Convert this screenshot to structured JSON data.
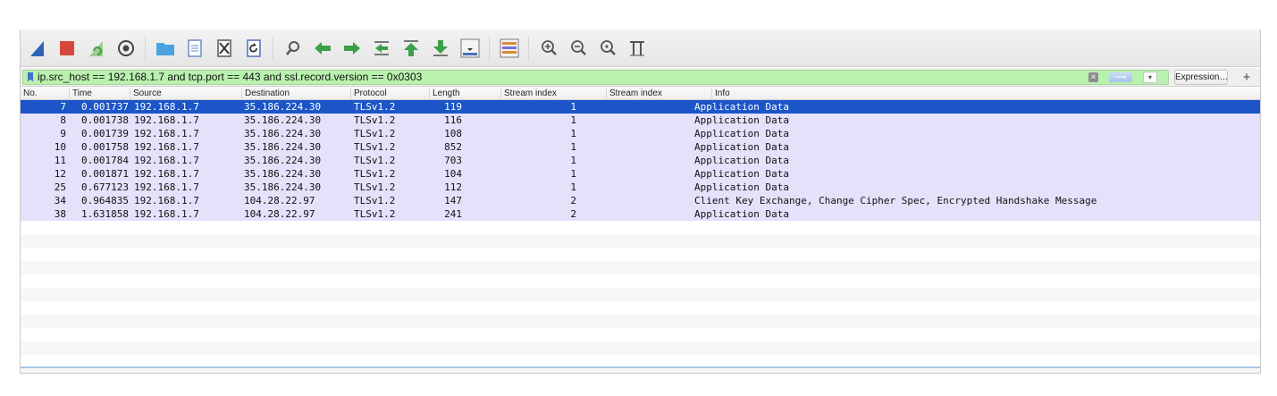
{
  "toolbar": {
    "buttons": [
      {
        "name": "start-capture-icon",
        "color": "#2f63b6"
      },
      {
        "name": "stop-capture-icon",
        "color": "#d6483c"
      },
      {
        "name": "restart-capture-icon",
        "color": "#3f9b3f"
      },
      {
        "name": "capture-options-icon",
        "color": "#444444"
      },
      {
        "name": "open-file-icon",
        "color": "#4aa3e0"
      },
      {
        "name": "save-file-icon",
        "color": "#6a8cc8"
      },
      {
        "name": "close-file-icon",
        "color": "#555555"
      },
      {
        "name": "reload-file-icon",
        "color": "#4a6fb5"
      },
      {
        "name": "find-packet-icon",
        "color": "#555555"
      },
      {
        "name": "go-back-icon",
        "color": "#3aa04a"
      },
      {
        "name": "go-forward-icon",
        "color": "#3aa04a"
      },
      {
        "name": "go-to-packet-icon",
        "color": "#3aa04a"
      },
      {
        "name": "go-first-packet-icon",
        "color": "#3aa04a"
      },
      {
        "name": "go-last-packet-icon",
        "color": "#3aa04a"
      },
      {
        "name": "auto-scroll-icon",
        "color": "#4a6fb5"
      },
      {
        "name": "colorize-icon",
        "color": "#d88c3a"
      },
      {
        "name": "zoom-in-icon",
        "color": "#555555"
      },
      {
        "name": "zoom-out-icon",
        "color": "#555555"
      },
      {
        "name": "normal-size-icon",
        "color": "#555555"
      },
      {
        "name": "resize-columns-icon",
        "color": "#555555"
      }
    ]
  },
  "filter": {
    "value": "ip.src_host == 192.168.1.7 and tcp.port == 443 and ssl.record.version == 0x0303",
    "valid_color": "#b9f1ae",
    "expression_label": "Expression…",
    "plus_label": "+"
  },
  "columns": [
    "No.",
    "Time",
    "Source",
    "Destination",
    "Protocol",
    "Length",
    "Stream index",
    "Stream index",
    "Info"
  ],
  "packets": [
    {
      "no": "7",
      "time": "0.001737",
      "src": "192.168.1.7",
      "dst": "35.186.224.30",
      "proto": "TLSv1.2",
      "len": "119",
      "stream1": "1",
      "stream2": "",
      "info": "Application Data",
      "selected": true
    },
    {
      "no": "8",
      "time": "0.001738",
      "src": "192.168.1.7",
      "dst": "35.186.224.30",
      "proto": "TLSv1.2",
      "len": "116",
      "stream1": "1",
      "stream2": "",
      "info": "Application Data"
    },
    {
      "no": "9",
      "time": "0.001739",
      "src": "192.168.1.7",
      "dst": "35.186.224.30",
      "proto": "TLSv1.2",
      "len": "108",
      "stream1": "1",
      "stream2": "",
      "info": "Application Data"
    },
    {
      "no": "10",
      "time": "0.001758",
      "src": "192.168.1.7",
      "dst": "35.186.224.30",
      "proto": "TLSv1.2",
      "len": "852",
      "stream1": "1",
      "stream2": "",
      "info": "Application Data"
    },
    {
      "no": "11",
      "time": "0.001784",
      "src": "192.168.1.7",
      "dst": "35.186.224.30",
      "proto": "TLSv1.2",
      "len": "703",
      "stream1": "1",
      "stream2": "",
      "info": "Application Data"
    },
    {
      "no": "12",
      "time": "0.001871",
      "src": "192.168.1.7",
      "dst": "35.186.224.30",
      "proto": "TLSv1.2",
      "len": "104",
      "stream1": "1",
      "stream2": "",
      "info": "Application Data"
    },
    {
      "no": "25",
      "time": "0.677123",
      "src": "192.168.1.7",
      "dst": "35.186.224.30",
      "proto": "TLSv1.2",
      "len": "112",
      "stream1": "1",
      "stream2": "",
      "info": "Application Data"
    },
    {
      "no": "34",
      "time": "0.964835",
      "src": "192.168.1.7",
      "dst": "104.28.22.97",
      "proto": "TLSv1.2",
      "len": "147",
      "stream1": "2",
      "stream2": "",
      "info": "Client Key Exchange, Change Cipher Spec, Encrypted Handshake Message"
    },
    {
      "no": "38",
      "time": "1.631858",
      "src": "192.168.1.7",
      "dst": "104.28.22.97",
      "proto": "TLSv1.2",
      "len": "241",
      "stream1": "2",
      "stream2": "",
      "info": "Application Data"
    }
  ],
  "colors": {
    "row_background": "#e4e1fb",
    "selected_background": "#1b55c8"
  }
}
